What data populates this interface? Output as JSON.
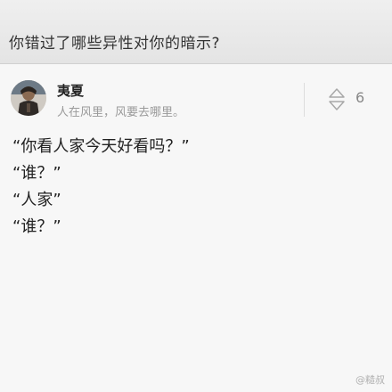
{
  "question": {
    "title": "你错过了哪些异性对你的暗示?"
  },
  "author": {
    "name": "夷夏",
    "bio": "人在风里，风要去哪里。"
  },
  "vote": {
    "icon": "updown-arrow-icon",
    "count": "6"
  },
  "answer": {
    "lines": [
      "“你看人家今天好看吗？”",
      "“谁？”",
      "“人家”",
      "“谁？”"
    ]
  },
  "watermark": {
    "text": "@糙叔"
  },
  "colors": {
    "header_bg": "#e8e8e8",
    "page_bg": "#f7f7f7",
    "text_primary": "#222222",
    "text_secondary": "#9a9a9a"
  }
}
